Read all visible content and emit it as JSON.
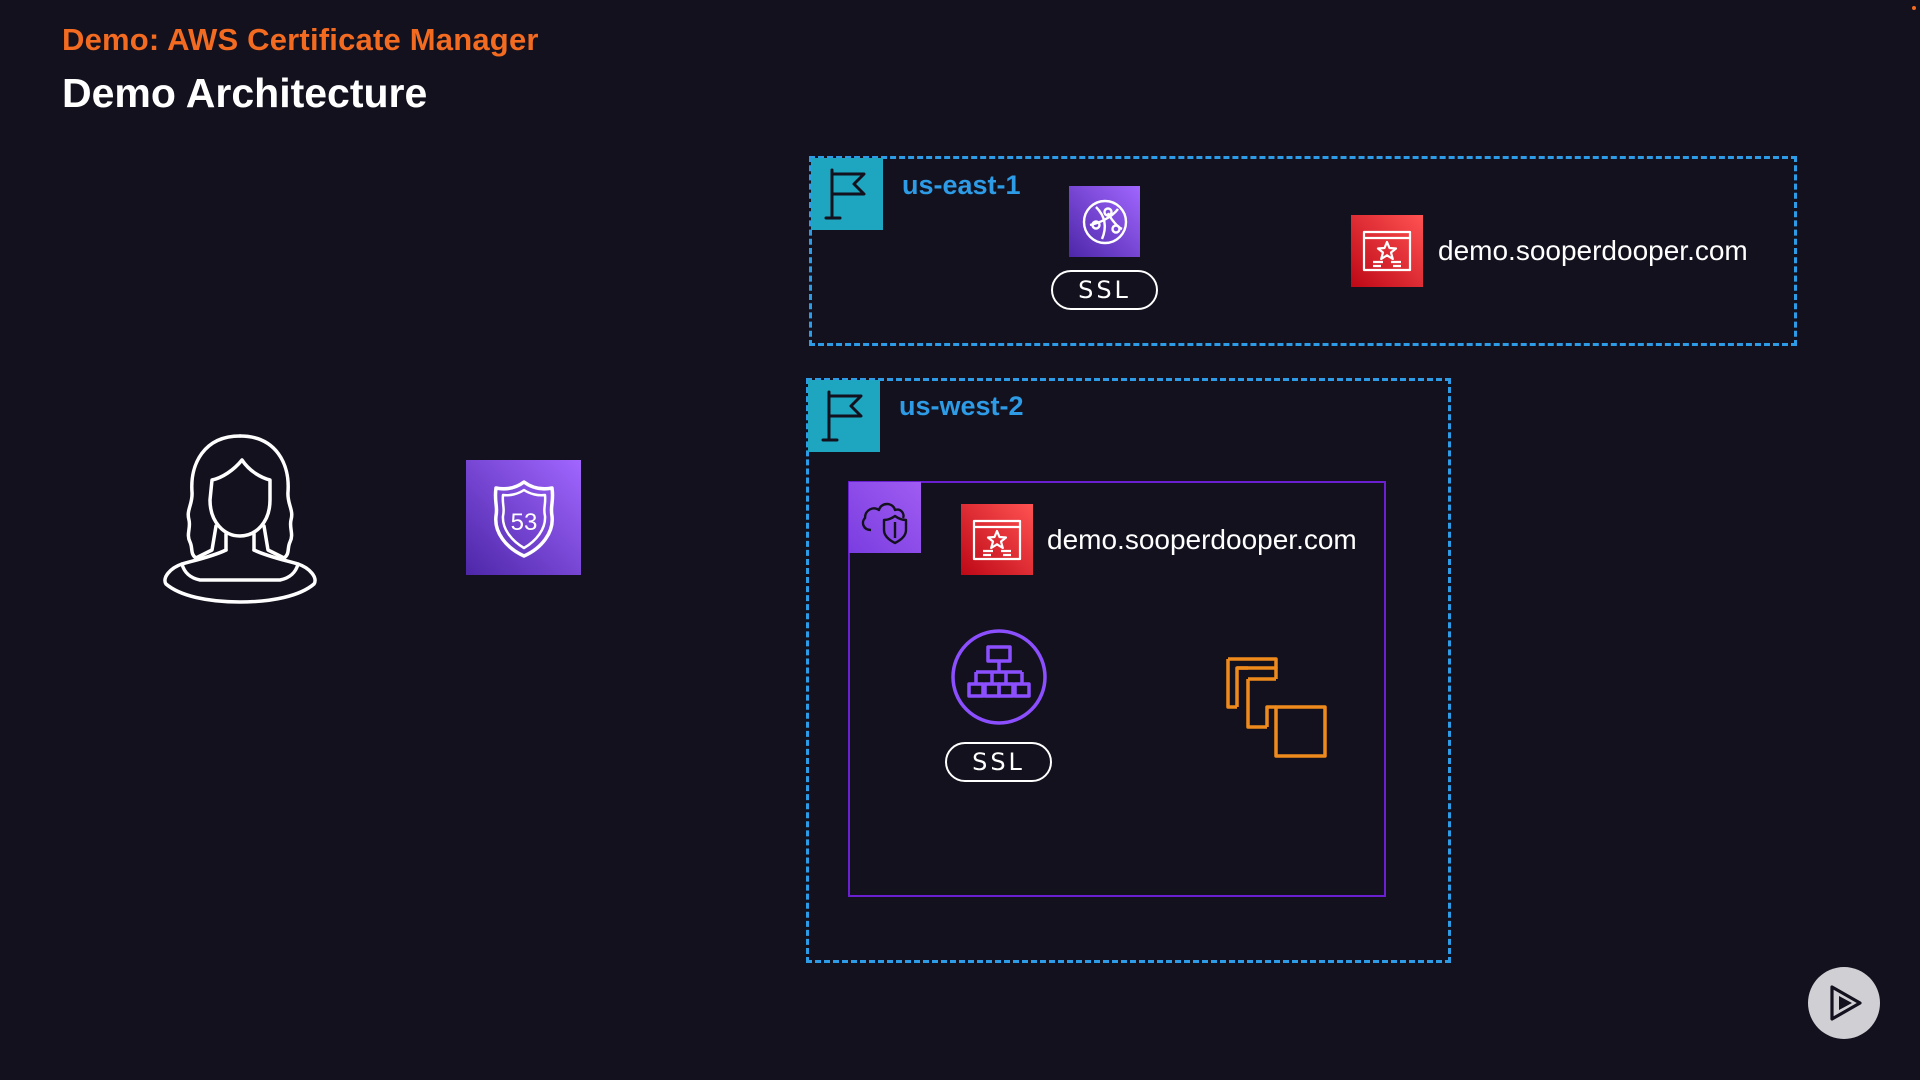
{
  "header": {
    "subtitle": "Demo: AWS Certificate Manager",
    "title": "Demo Architecture"
  },
  "regions": [
    {
      "label": "us-east-1",
      "icon": "region-flag-icon",
      "services": [
        {
          "icon": "cloudfront-icon",
          "badge": "SSL"
        },
        {
          "icon": "acm-certificate-icon",
          "domain": "demo.sooperdooper.com"
        }
      ]
    },
    {
      "label": "us-west-2",
      "icon": "region-flag-icon",
      "vpc": {
        "icon": "vpc-cloud-shield-icon",
        "certificate": {
          "icon": "acm-certificate-icon",
          "domain": "demo.sooperdooper.com"
        },
        "load_balancer": {
          "icon": "elastic-load-balancer-icon",
          "badge": "SSL"
        },
        "instances": {
          "icon": "ec2-instances-icon"
        }
      }
    }
  ],
  "left": {
    "user_icon": "user-icon",
    "dns_icon": "route53-icon",
    "dns_number": "53"
  },
  "colors": {
    "background": "#13111e",
    "accent_orange": "#f26b21",
    "region_blue": "#2d9be6",
    "flag_teal": "#1ea5bf",
    "vpc_purple": "#6a1fd0",
    "cert_red": "#d6172b",
    "service_purple": "#7b3ee6",
    "instance_orange": "#ef8a1c"
  },
  "player": {
    "icon": "play-icon"
  }
}
